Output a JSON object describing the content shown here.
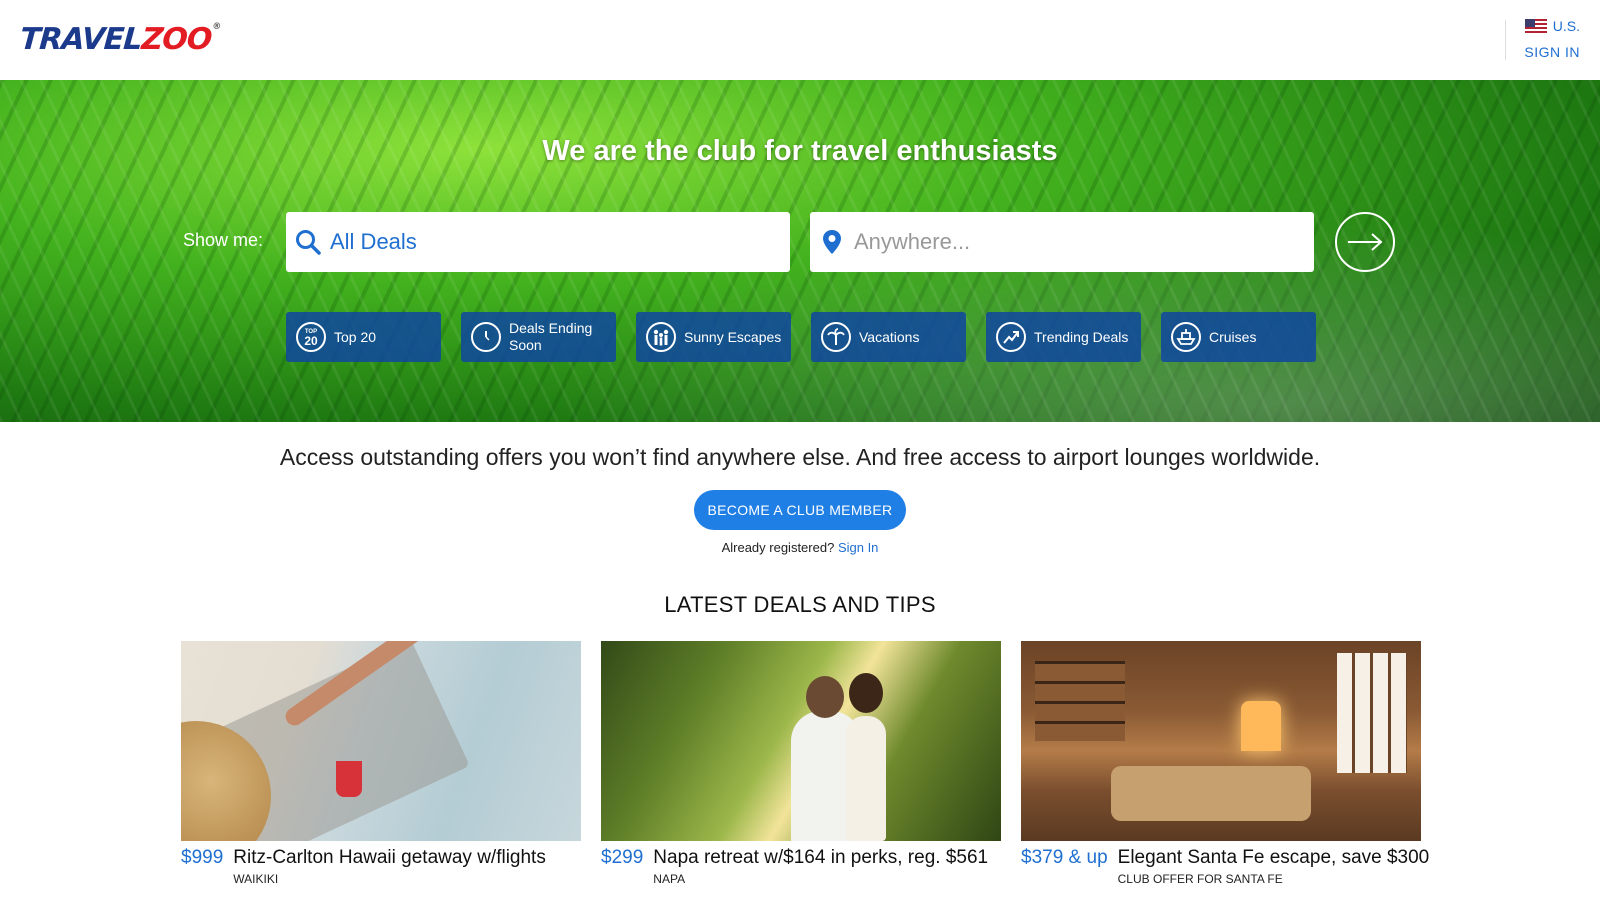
{
  "header": {
    "logo": {
      "part1": "TRAVEL",
      "part2": "ZOO",
      "mark": "®"
    },
    "locale": "U.S.",
    "sign_in": "SIGN IN"
  },
  "hero": {
    "title": "We are the club for travel enthusiasts",
    "show_me": "Show me:",
    "deal_type_value": "All Deals",
    "location_placeholder": "Anywhere...",
    "categories": [
      {
        "label": "Top 20",
        "icon": "top-20-icon",
        "badge_top": "TOP",
        "badge_num": "20"
      },
      {
        "label": "Deals Ending Soon",
        "icon": "clock-icon"
      },
      {
        "label": "Sunny Escapes",
        "icon": "people-icon"
      },
      {
        "label": "Vacations",
        "icon": "palm-tree-icon"
      },
      {
        "label": "Trending Deals",
        "icon": "trending-up-icon"
      },
      {
        "label": "Cruises",
        "icon": "cruise-ship-icon"
      }
    ]
  },
  "promo": {
    "tagline": "Access outstanding offers you won’t find anywhere else. And free access to airport lounges worldwide.",
    "join_button": "BECOME A CLUB MEMBER",
    "already_text": "Already registered?",
    "sign_in_link": "Sign In"
  },
  "latest": {
    "title": "LATEST DEALS AND TIPS",
    "deals": [
      {
        "price": "$999",
        "title": "Ritz-Carlton Hawaii getaway w/flights",
        "location": "WAIKIKI"
      },
      {
        "price": "$299",
        "title": "Napa retreat w/$164 in perks, reg. $561",
        "location": "NAPA"
      },
      {
        "price": "$379 & up",
        "title": "Elegant Santa Fe escape, save $300",
        "location": "CLUB OFFER FOR SANTA FE"
      }
    ]
  },
  "colors": {
    "brand_blue": "#1f6fd1",
    "logo_navy": "#1b3a8c",
    "logo_red": "#e31b23",
    "button_blue": "#1f7fe5",
    "chip_blue": "#0f46a0"
  }
}
